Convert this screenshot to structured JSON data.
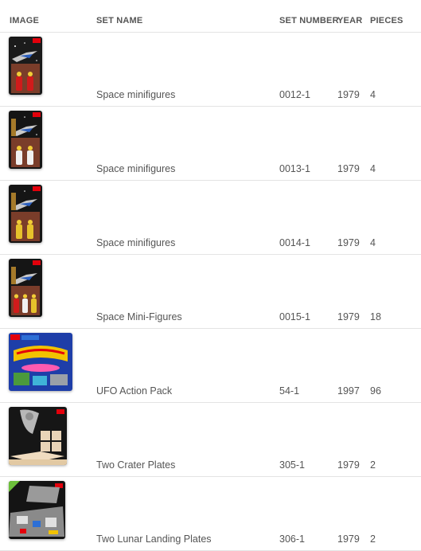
{
  "table": {
    "headers": {
      "image": "IMAGE",
      "set_name": "SET NAME",
      "set_number": "SET NUMBER",
      "year": "YEAR",
      "pieces": "PIECES"
    },
    "rows": [
      {
        "name": "Space minifigures",
        "number": "0012-1",
        "year": "1979",
        "pieces": "4",
        "image": "lego-space-blister-red-figures"
      },
      {
        "name": "Space minifigures",
        "number": "0013-1",
        "year": "1979",
        "pieces": "4",
        "image": "lego-space-blister-white-figures"
      },
      {
        "name": "Space minifigures",
        "number": "0014-1",
        "year": "1979",
        "pieces": "4",
        "image": "lego-space-blister-yellow-figures"
      },
      {
        "name": "Space Mini-Figures",
        "number": "0015-1",
        "year": "1979",
        "pieces": "18",
        "image": "lego-space-blister-mixed-figures"
      },
      {
        "name": "UFO Action Pack",
        "number": "54-1",
        "year": "1997",
        "pieces": "96",
        "image": "lego-ufo-action-pack-box"
      },
      {
        "name": "Two Crater Plates",
        "number": "305-1",
        "year": "1979",
        "pieces": "2",
        "image": "lego-crater-plates-box"
      },
      {
        "name": "Two Lunar Landing Plates",
        "number": "306-1",
        "year": "1979",
        "pieces": "2",
        "image": "lego-lunar-landing-plates-box"
      }
    ]
  },
  "colors": {
    "text": "#555555",
    "divider": "#e4e4e4",
    "lego_red": "#e3000b",
    "space_black": "#111111"
  }
}
